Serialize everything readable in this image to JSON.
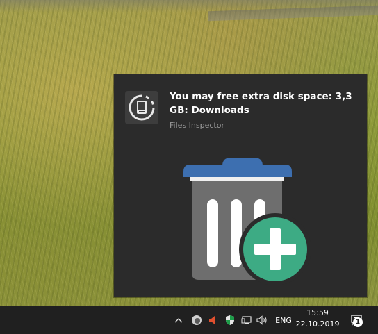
{
  "toast": {
    "title": "You may free extra disk space: 3,3 GB: Downloads",
    "source": "Files Inspector",
    "app_icon": "files-inspector-icon",
    "hero_icon": "trash-can-plus-icon"
  },
  "taskbar": {
    "tray_icons": [
      "show-hidden-icons-chevron",
      "app-tray-icon",
      "speaker-muted-icon",
      "windows-security-icon",
      "network-icon",
      "volume-icon"
    ],
    "language": "ENG",
    "time": "15:59",
    "date": "22.10.2019",
    "notification_count": "1"
  },
  "colors": {
    "toast_background": "#2b2b2b",
    "taskbar_background": "#202020",
    "trash_lid": "#3d6fb0",
    "trash_body": "#6e6e6e",
    "plus_circle": "#3dab84"
  }
}
